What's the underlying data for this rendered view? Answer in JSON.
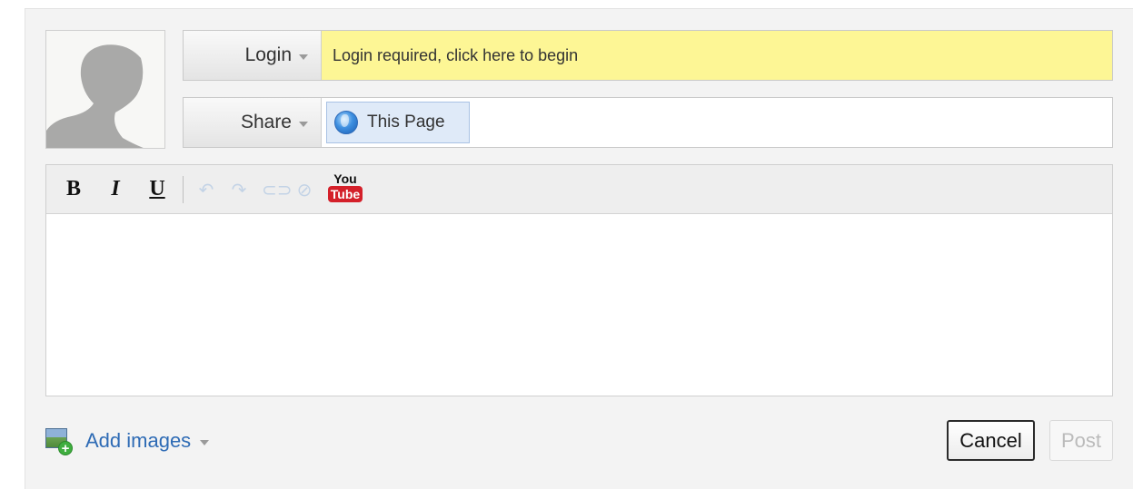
{
  "identity": {
    "login_label": "Login",
    "login_prompt": "Login required, click here to begin"
  },
  "share": {
    "share_label": "Share",
    "target_label": "This Page"
  },
  "toolbar": {
    "bold_label": "B",
    "italic_label": "I",
    "underline_label": "U",
    "icons": [
      "undo-icon",
      "redo-icon",
      "link-icon",
      "unlink-icon",
      "youtube-icon"
    ],
    "youtube_top": "You",
    "youtube_bottom": "Tube"
  },
  "editor": {
    "content": ""
  },
  "footer": {
    "add_images_label": "Add images",
    "cancel_label": "Cancel",
    "post_label": "Post"
  },
  "colors": {
    "login_prompt_bg": "#fdf695",
    "link_blue": "#2e6bb5",
    "youtube_red": "#d4202a"
  }
}
